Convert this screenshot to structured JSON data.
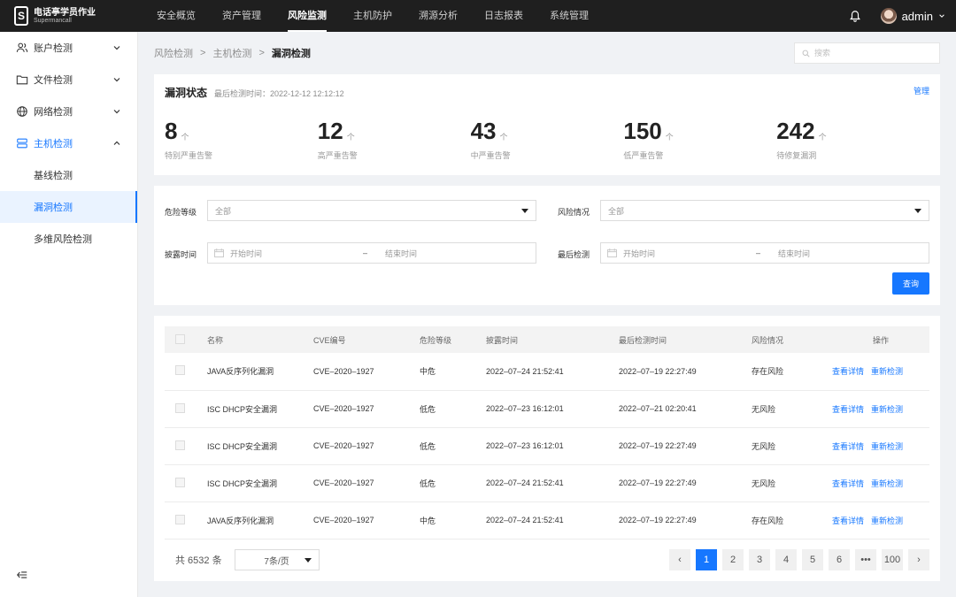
{
  "brand": {
    "name": "电话亭学员作业",
    "sub": "Supermancall",
    "logo_letter": "S"
  },
  "topnav": [
    {
      "label": "安全概览"
    },
    {
      "label": "资产管理"
    },
    {
      "label": "风险监测",
      "active": true
    },
    {
      "label": "主机防护"
    },
    {
      "label": "溯源分析"
    },
    {
      "label": "日志报表"
    },
    {
      "label": "系统管理"
    }
  ],
  "user": {
    "name": "admin"
  },
  "sidebar": {
    "items": [
      {
        "label": "账户检测",
        "icon": "users-icon"
      },
      {
        "label": "文件检测",
        "icon": "folder-icon"
      },
      {
        "label": "网络检测",
        "icon": "globe-icon"
      },
      {
        "label": "主机检测",
        "icon": "server-icon",
        "open": true
      }
    ],
    "sub": [
      {
        "label": "基线检测"
      },
      {
        "label": "漏洞检测",
        "active": true
      },
      {
        "label": "多维风险检测"
      }
    ]
  },
  "breadcrumb": {
    "l1": "风险检测",
    "l2": "主机检测",
    "current": "漏洞检测",
    "sep": ">"
  },
  "search": {
    "placeholder": "搜索"
  },
  "status": {
    "title": "漏洞状态",
    "time": "最后检测时间：2022-12-12 12:12:12",
    "manage": "管理",
    "unit": "个",
    "stats": [
      {
        "num": "8",
        "label": "特别严重告警"
      },
      {
        "num": "12",
        "label": "高严重告警"
      },
      {
        "num": "43",
        "label": "中严重告警"
      },
      {
        "num": "150",
        "label": "低严重告警"
      },
      {
        "num": "242",
        "label": "待修复漏洞"
      }
    ]
  },
  "filter": {
    "risk_level_label": "危险等级",
    "risk_level_value": "全部",
    "risk_state_label": "风险情况",
    "risk_state_value": "全部",
    "disclose_label": "披露时间",
    "last_check_label": "最后检测",
    "start_placeholder": "开始时间",
    "end_placeholder": "结束时间",
    "dash": "–",
    "query": "查询"
  },
  "table": {
    "headers": [
      "名称",
      "CVE编号",
      "危险等级",
      "披露时间",
      "最后检测时间",
      "风险情况",
      "操作"
    ],
    "op_view": "查看详情",
    "op_recheck": "重新检测",
    "rows": [
      [
        "JAVA反序列化漏洞",
        "CVE–2020–1927",
        "中危",
        "2022–07–24 21:52:41",
        "2022–07–19 22:27:49",
        "存在风险"
      ],
      [
        "ISC DHCP安全漏洞",
        "CVE–2020–1927",
        "低危",
        "2022–07–23 16:12:01",
        "2022–07–21 02:20:41",
        "无风险"
      ],
      [
        "ISC DHCP安全漏洞",
        "CVE–2020–1927",
        "低危",
        "2022–07–23 16:12:01",
        "2022–07–19 22:27:49",
        "无风险"
      ],
      [
        "ISC DHCP安全漏洞",
        "CVE–2020–1927",
        "低危",
        "2022–07–24 21:52:41",
        "2022–07–19 22:27:49",
        "无风险"
      ],
      [
        "JAVA反序列化漏洞",
        "CVE–2020–1927",
        "中危",
        "2022–07–24 21:52:41",
        "2022–07–19 22:27:49",
        "存在风险"
      ]
    ]
  },
  "pager": {
    "total": "共 6532 条",
    "page_size": "7条/页",
    "prev": "‹",
    "next": "›",
    "pages": [
      "1",
      "2",
      "3",
      "4",
      "5",
      "6",
      "•••",
      "100"
    ],
    "current": "1"
  },
  "colors": {
    "accent": "#1677ff",
    "topbar": "#1f1f1f"
  }
}
